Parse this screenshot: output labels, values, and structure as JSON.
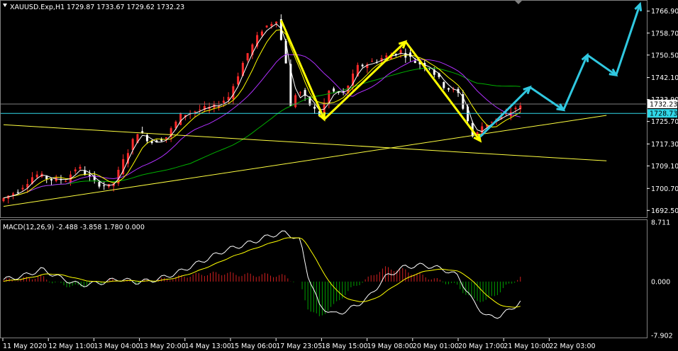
{
  "window": {
    "title": "XAUUSD.Exp,H1",
    "ohlc": "1729.87 1733.67 1729.62 1732.23"
  },
  "colors": {
    "background": "#000000",
    "grid": "#404040",
    "axis_text": "#ffffff",
    "bull_candle": "#ff2a2a",
    "bear_candle": "#ffffff",
    "ma_fast": "#ffffff",
    "ma_mid": "#ffff00",
    "ma_slow_purple": "#b030ff",
    "ma_slow_green": "#00b000",
    "trend_line": "#ffff40",
    "zigzag": "#ffff00",
    "forecast": "#30c8e0",
    "h_line": "#30d8e8",
    "price_tag_bid": "#000000",
    "price_tag_cur": "#000000",
    "macd_hist_pos": "#d02020",
    "macd_hist_neg": "#00a000",
    "macd_line": "#ffffff",
    "signal_line": "#ffff00"
  },
  "chart_data": [
    {
      "type": "candlestick",
      "title": "XAUUSD.Exp,H1",
      "ylim": [
        1691.0,
        1770.0
      ],
      "yticks": [
        "1766.90",
        "1758.70",
        "1750.50",
        "1742.10",
        "1733.90",
        "1725.70",
        "1717.30",
        "1709.10",
        "1700.70",
        "1692.50"
      ],
      "price_tags": [
        "1732.23",
        "1728.73"
      ],
      "xtick_labels": [
        "11 May 2020",
        "12 May 11:00",
        "13 May 04:00",
        "13 May 20:00",
        "14 May 13:00",
        "15 May 06:00",
        "17 May 23:05",
        "18 May 15:00",
        "19 May 08:00",
        "20 May 01:00",
        "20 May 17:00",
        "21 May 10:00",
        "22 May 03:00"
      ],
      "price_path": [
        {
          "i": 0,
          "y": 1696
        },
        {
          "i": 20,
          "y": 1700
        },
        {
          "i": 38,
          "y": 1706
        },
        {
          "i": 55,
          "y": 1704
        },
        {
          "i": 70,
          "y": 1704
        },
        {
          "i": 82,
          "y": 1709
        },
        {
          "i": 100,
          "y": 1703
        },
        {
          "i": 118,
          "y": 1701
        },
        {
          "i": 130,
          "y": 1711
        },
        {
          "i": 145,
          "y": 1722
        },
        {
          "i": 160,
          "y": 1718
        },
        {
          "i": 175,
          "y": 1720
        },
        {
          "i": 190,
          "y": 1728
        },
        {
          "i": 208,
          "y": 1730
        },
        {
          "i": 225,
          "y": 1731
        },
        {
          "i": 240,
          "y": 1735
        },
        {
          "i": 258,
          "y": 1750
        },
        {
          "i": 275,
          "y": 1760
        },
        {
          "i": 290,
          "y": 1764
        },
        {
          "i": 300,
          "y": 1748
        },
        {
          "i": 305,
          "y": 1731
        },
        {
          "i": 312,
          "y": 1738
        },
        {
          "i": 325,
          "y": 1732
        },
        {
          "i": 335,
          "y": 1728
        },
        {
          "i": 345,
          "y": 1737
        },
        {
          "i": 360,
          "y": 1736
        },
        {
          "i": 375,
          "y": 1746
        },
        {
          "i": 390,
          "y": 1748
        },
        {
          "i": 405,
          "y": 1750
        },
        {
          "i": 420,
          "y": 1752
        },
        {
          "i": 435,
          "y": 1748
        },
        {
          "i": 450,
          "y": 1746
        },
        {
          "i": 465,
          "y": 1739
        },
        {
          "i": 480,
          "y": 1736
        },
        {
          "i": 490,
          "y": 1726
        },
        {
          "i": 496,
          "y": 1719
        },
        {
          "i": 505,
          "y": 1724
        },
        {
          "i": 515,
          "y": 1726
        },
        {
          "i": 530,
          "y": 1728
        },
        {
          "i": 540,
          "y": 1731
        }
      ],
      "zigzag": [
        {
          "i": 290,
          "y": 1763.5
        },
        {
          "i": 335,
          "y": 1726.5
        },
        {
          "i": 420,
          "y": 1755.5
        },
        {
          "i": 498,
          "y": 1718.5
        }
      ],
      "forecast_path": [
        {
          "i": 498,
          "y": 1720
        },
        {
          "i": 550,
          "y": 1738.5
        },
        {
          "i": 585,
          "y": 1730
        },
        {
          "i": 610,
          "y": 1750.5
        },
        {
          "i": 640,
          "y": 1743
        },
        {
          "i": 665,
          "y": 1769.5
        }
      ],
      "hlines": [
        1732.23,
        1728.73
      ],
      "trend_lines": [
        {
          "from": {
            "i": 0,
            "y": 1724.5
          },
          "to": {
            "i": 630,
            "y": 1711.0
          }
        },
        {
          "from": {
            "i": 0,
            "y": 1694.0
          },
          "to": {
            "i": 630,
            "y": 1728.0
          }
        }
      ]
    },
    {
      "type": "macd",
      "title": "MACD(12,26,9) -2.488 -3.858 1.780 0.000",
      "params": "MACD(12,26,9)",
      "values": {
        "macd": -2.488,
        "signal": -3.858,
        "hist": 1.78,
        "level": 0.0
      },
      "ylim": [
        -7.902,
        8.711
      ],
      "yticks": [
        "8.711",
        "0.000",
        "-7.902"
      ]
    }
  ]
}
